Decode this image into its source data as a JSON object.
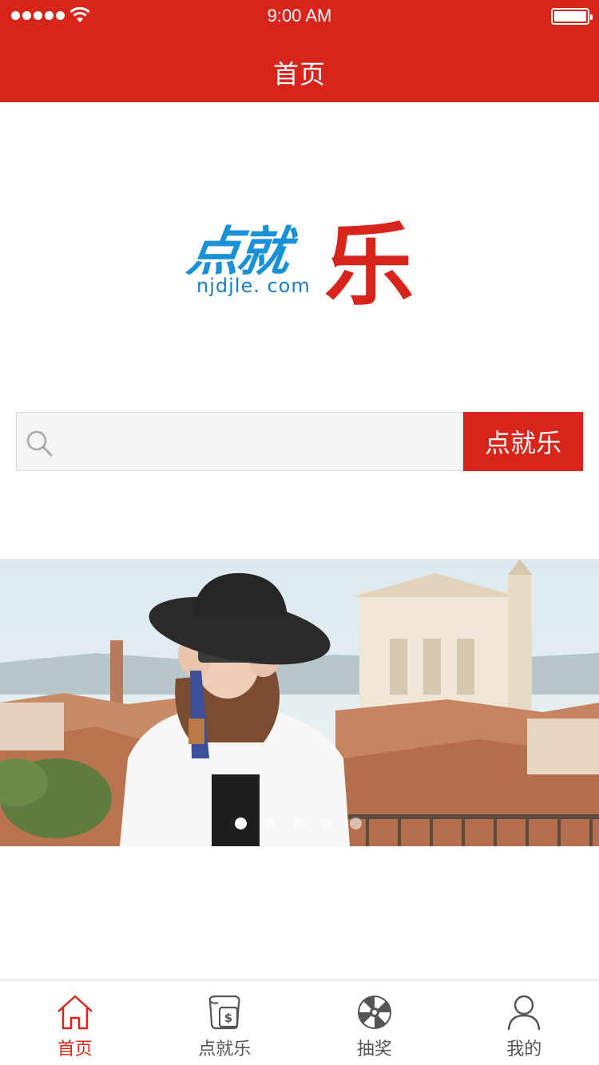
{
  "status_bar": {
    "time": "9:00 AM"
  },
  "nav": {
    "title": "首页"
  },
  "logo": {
    "blue_text": "点就",
    "red_text": "乐",
    "domain": "njdjle. com"
  },
  "search": {
    "placeholder": "",
    "value": "",
    "button_label": "点就乐"
  },
  "banner": {
    "slide_count": 5,
    "active_index": 0
  },
  "tabbar": {
    "items": [
      {
        "label": "首页",
        "icon": "home-icon",
        "active": true
      },
      {
        "label": "点就乐",
        "icon": "money-bag-icon",
        "active": false
      },
      {
        "label": "抽奖",
        "icon": "lottery-wheel-icon",
        "active": false
      },
      {
        "label": "我的",
        "icon": "user-icon",
        "active": false
      }
    ]
  },
  "colors": {
    "brand_red": "#d9241c",
    "logo_blue": "#1a91d6",
    "inactive_gray": "#555555"
  }
}
